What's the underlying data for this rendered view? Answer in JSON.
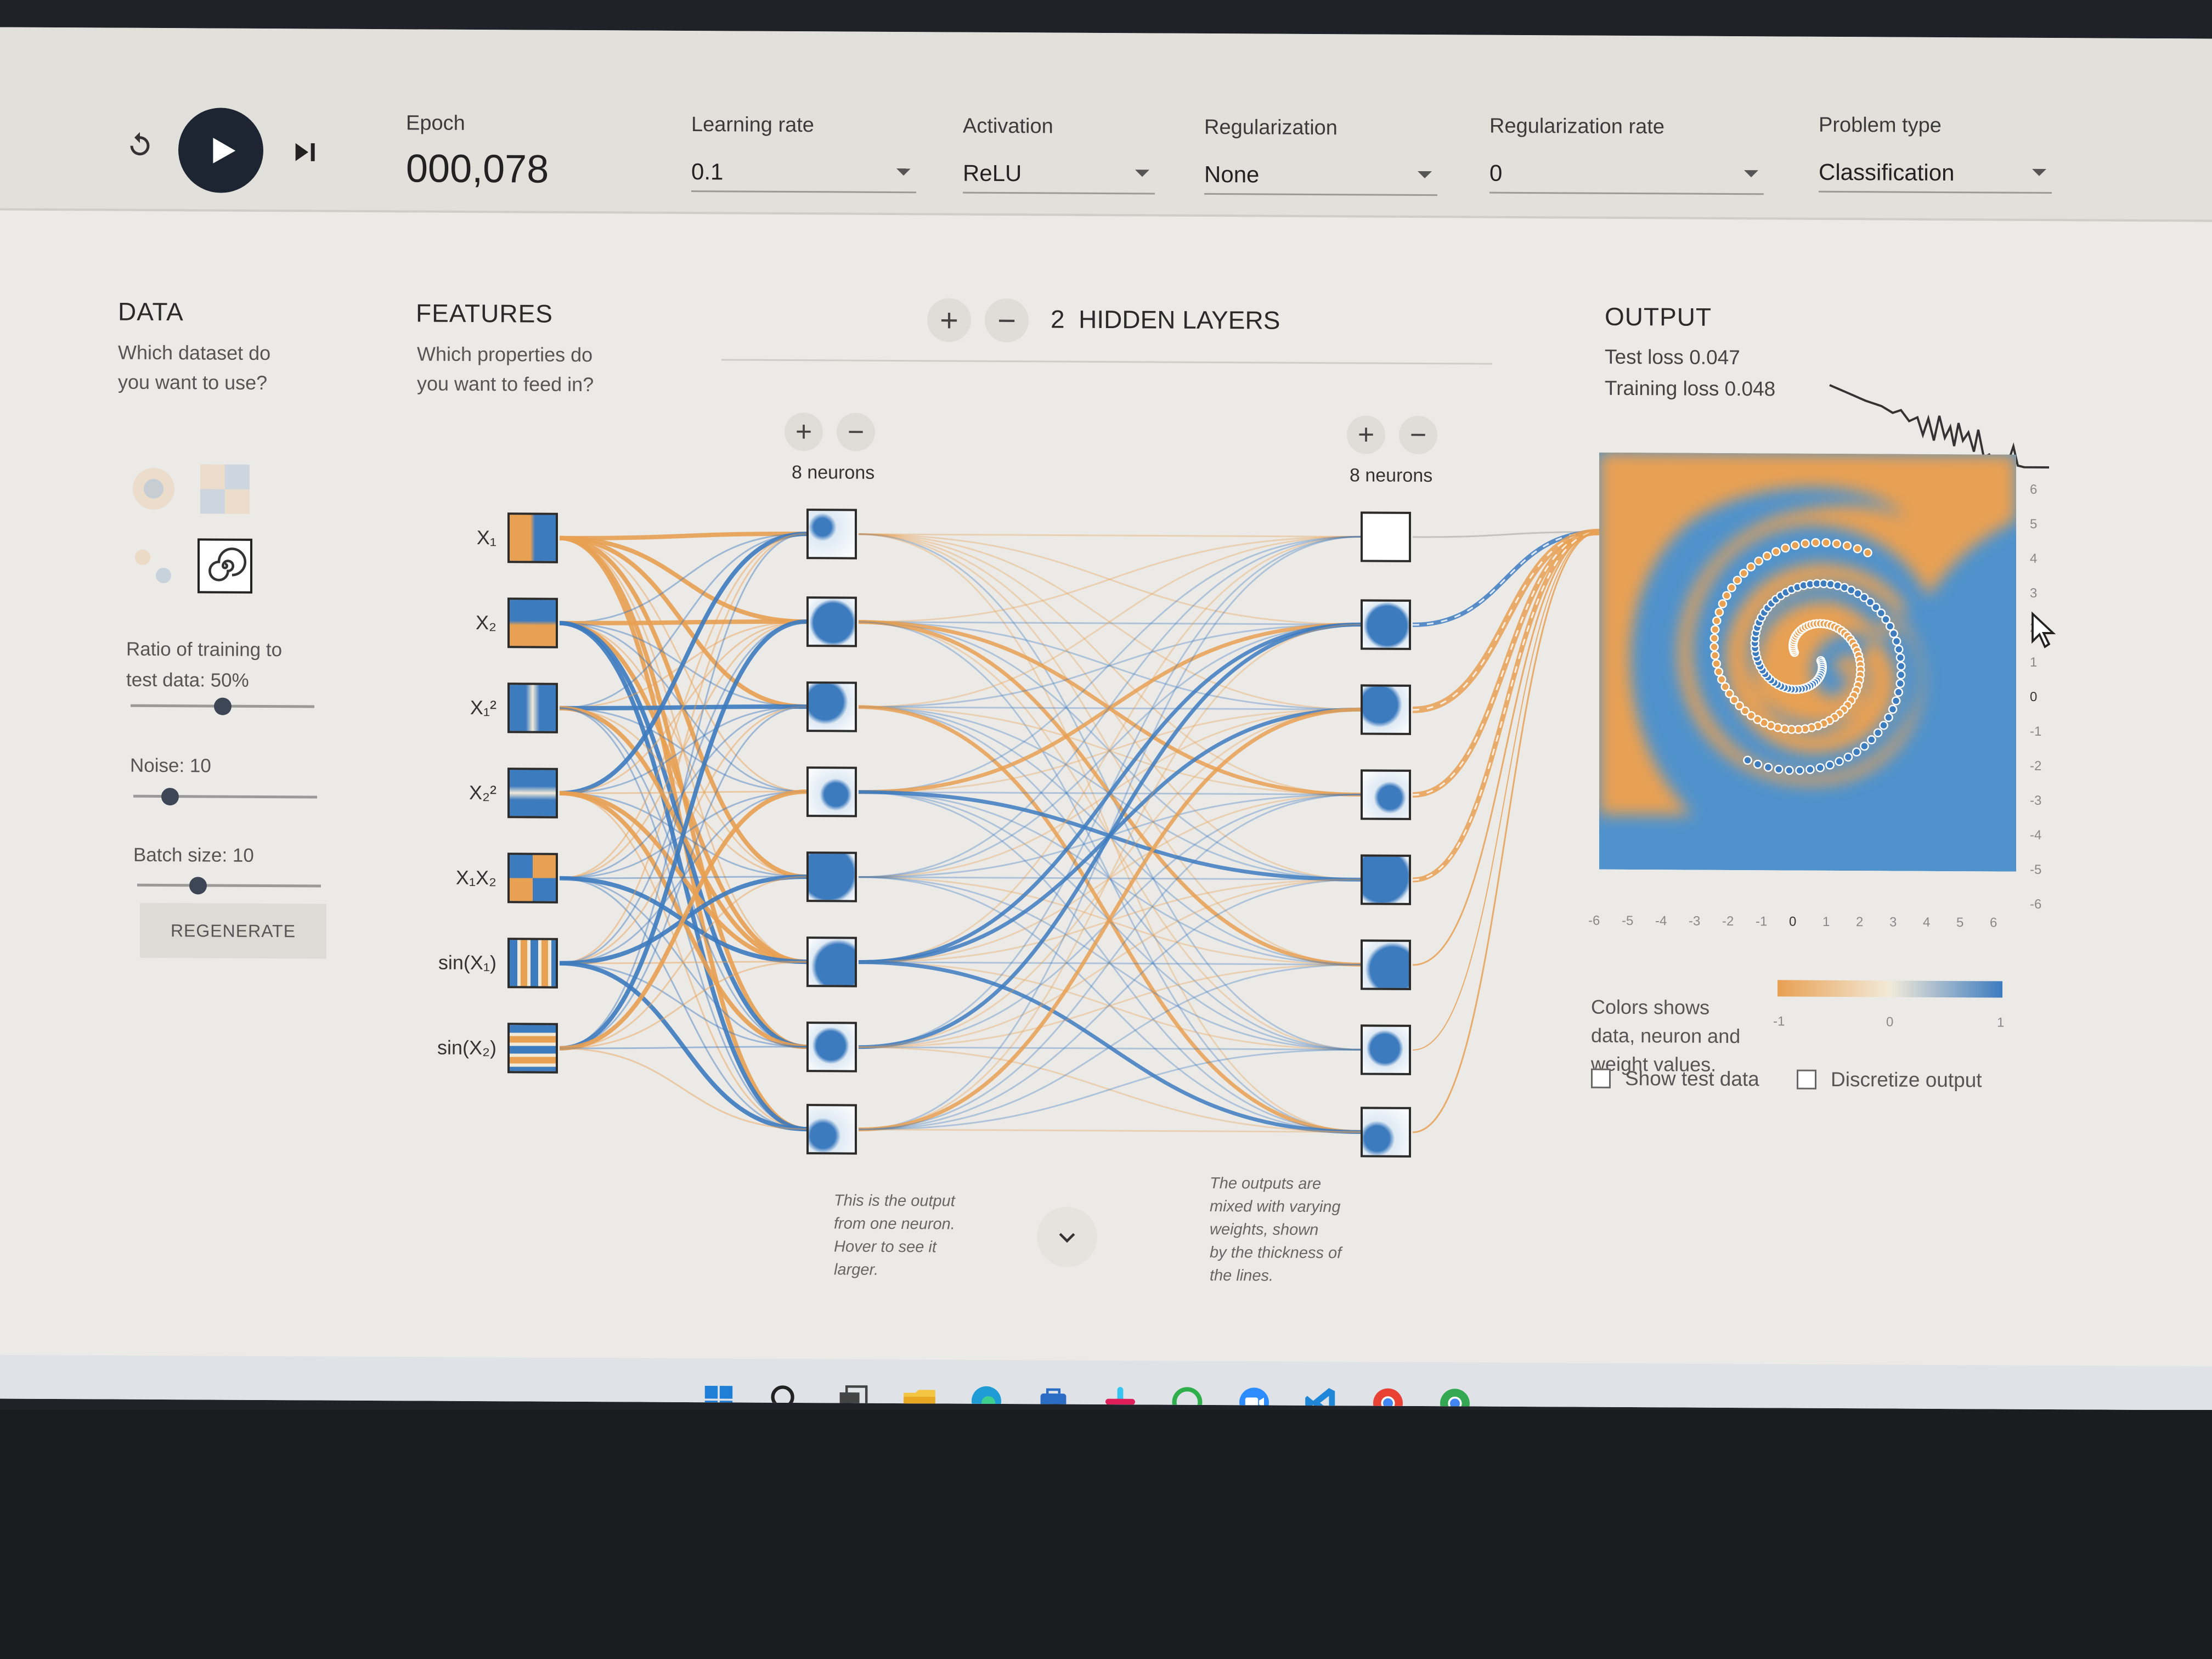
{
  "controls": {
    "epoch_label": "Epoch",
    "epoch_value": "000,078",
    "learning_rate_label": "Learning rate",
    "learning_rate_value": "0.1",
    "activation_label": "Activation",
    "activation_value": "ReLU",
    "regularization_label": "Regularization",
    "regularization_value": "None",
    "regularization_rate_label": "Regularization rate",
    "regularization_rate_value": "0",
    "problem_type_label": "Problem type",
    "problem_type_value": "Classification"
  },
  "data_panel": {
    "title": "DATA",
    "subtitle_line1": "Which dataset do",
    "subtitle_line2": "you want to use?",
    "ratio_label_line1": "Ratio of training to",
    "ratio_label_line2": "test data:  50%",
    "ratio_value": 0.5,
    "noise_label": "Noise:  10",
    "noise_value": 0.2,
    "batch_label": "Batch size:  10",
    "batch_value": 0.33,
    "regenerate_label": "REGENERATE"
  },
  "features_panel": {
    "title": "FEATURES",
    "subtitle_line1": "Which properties do",
    "subtitle_line2": "you want to feed in?",
    "features": [
      "X₁",
      "X₂",
      "X₁²",
      "X₂²",
      "X₁X₂",
      "sin(X₁)",
      "sin(X₂)"
    ]
  },
  "hidden_layers": {
    "count": "2",
    "title": "HIDDEN LAYERS",
    "layer1_neurons": "8 neurons",
    "layer2_neurons": "8 neurons",
    "add_symbol": "+",
    "remove_symbol": "−"
  },
  "output_panel": {
    "title": "OUTPUT",
    "test_loss": "Test loss 0.047",
    "training_loss": "Training loss 0.048",
    "x_ticks": [
      "-6",
      "-5",
      "-4",
      "-3",
      "-2",
      "-1",
      "0",
      "1",
      "2",
      "3",
      "4",
      "5",
      "6"
    ],
    "y_ticks": [
      "6",
      "5",
      "4",
      "3",
      "2",
      "1",
      "0",
      "-1",
      "-2",
      "-3",
      "-4",
      "-5",
      "-6"
    ],
    "legend_line1": "Colors shows",
    "legend_line2": "data, neuron and",
    "legend_line3": "weight values.",
    "legend_min": "-1",
    "legend_mid": "0",
    "legend_max": "1",
    "show_test_label": "Show test data",
    "discretize_label": "Discretize output"
  },
  "notes": {
    "neuron_note": [
      "This is the output",
      "from one neuron.",
      "Hover to see it",
      "larger."
    ],
    "weights_note": [
      "The outputs are",
      "mixed with varying",
      "weights, shown",
      "by the thickness of",
      "the lines."
    ]
  },
  "colors": {
    "orange": "#e8a052",
    "blue": "#3d7bbf",
    "dark_button": "#1d2532"
  },
  "taskbar_icons": [
    "windows-icon",
    "search-icon",
    "task-view-icon",
    "file-explorer-icon",
    "edge-icon",
    "store-icon",
    "slack-icon",
    "circle-app-icon",
    "zoom-icon",
    "vscode-icon",
    "chrome-profile-m-icon",
    "chrome-profile-icon"
  ]
}
